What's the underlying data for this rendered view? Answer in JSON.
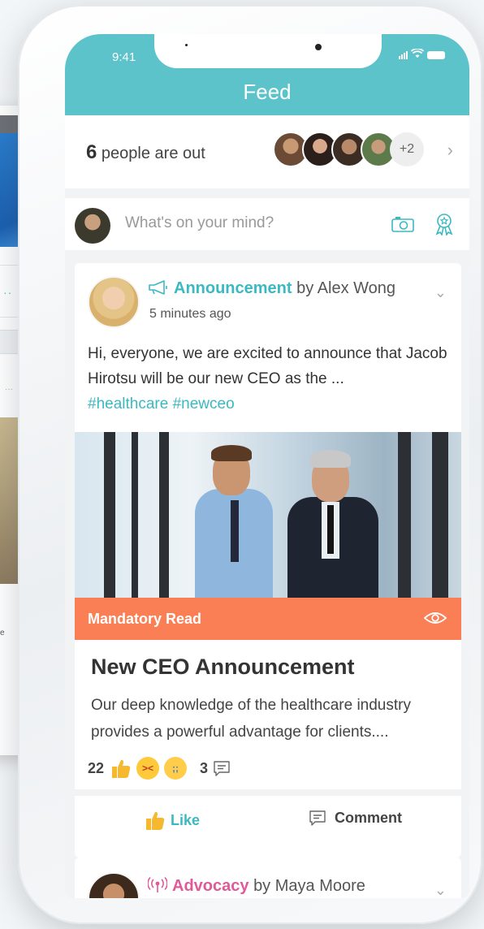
{
  "status": {
    "time": "9:41"
  },
  "header": {
    "title": "Feed"
  },
  "people_out": {
    "count": "6",
    "label": "people are out",
    "more": "+2"
  },
  "composer": {
    "placeholder": "What's on your mind?"
  },
  "post": {
    "type_label": "Announcement",
    "by_label": "by Alex Wong",
    "time": "5 minutes ago",
    "body": "Hi, everyone, we are excited to announce that Jacob Hirotsu will be our new CEO as the ...",
    "hashtags": "#healthcare #newceo",
    "mandatory_label": "Mandatory Read",
    "article_title": "New CEO Announcement",
    "article_desc": "Our deep knowledge of the healthcare industry provides a powerful advantage for clients....",
    "reaction_count": "22",
    "comment_count": "3",
    "like_label": "Like",
    "comment_label": "Comment"
  },
  "next_post": {
    "type_label": "Advocacy",
    "by_label": "by Maya Moore"
  },
  "colors": {
    "teal": "#5cc3cb",
    "accent": "#3bb9c1",
    "mandatory": "#fa7f55",
    "advocacy": "#e05a9a"
  },
  "icons": [
    "camera-icon",
    "award-icon",
    "megaphone-icon",
    "eye-icon",
    "thumbs-up-icon",
    "comment-icon",
    "antenna-icon",
    "chevron-down-icon",
    "chevron-right-icon"
  ]
}
